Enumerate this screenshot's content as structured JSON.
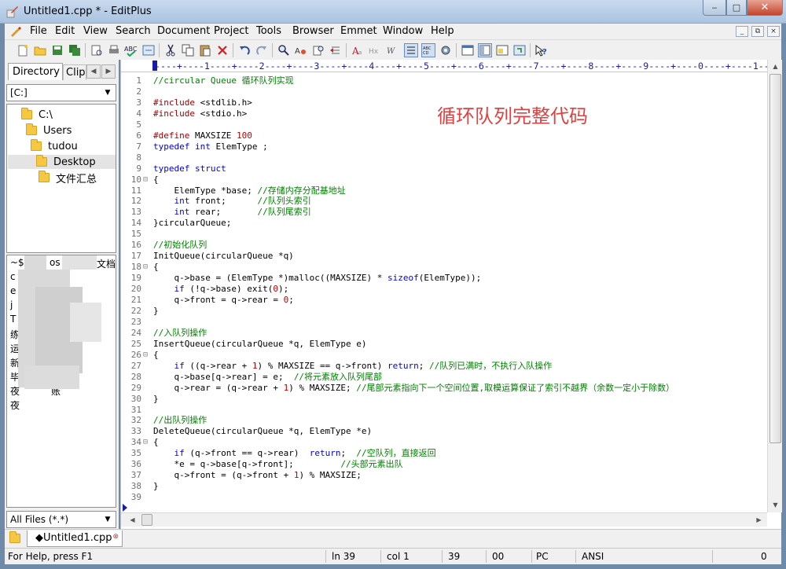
{
  "window": {
    "title": "Untitled1.cpp * - EditPlus",
    "min_glyph": "‒",
    "max_glyph": "□",
    "close_glyph": "✕"
  },
  "menu": [
    "File",
    "Edit",
    "View",
    "Search",
    "Document",
    "Project",
    "Tools",
    "Browser",
    "Emmet",
    "Window",
    "Help"
  ],
  "mdi_buttons": [
    "_",
    "⧉",
    "×"
  ],
  "left_panel": {
    "tabs": [
      "Directory",
      "Cliptext"
    ],
    "drive": "[C:]",
    "tree": [
      {
        "label": "C:\\",
        "selected": false
      },
      {
        "label": "Users",
        "selected": false
      },
      {
        "label": "tudou",
        "selected": false
      },
      {
        "label": "Desktop",
        "selected": true
      },
      {
        "label": "文件汇总",
        "selected": false
      }
    ],
    "file_list": [
      "~$",
      "os",
      "文档",
      "c",
      "e",
      "j",
      "T",
      "练",
      "运",
      "新",
      "毕",
      "夜",
      "夜",
      "账"
    ],
    "file_filter": "All Files (*.*)"
  },
  "editor": {
    "ruler": "----+----1----+----2----+----3----+----4----+----5----+----6----+----7----+----8----+----9----+----0----+----1---",
    "annotation": "循环队列完整代码",
    "lines": [
      {
        "n": "1",
        "fold": "",
        "segs": [
          [
            "c",
            "//circular Queue 循环队列实现"
          ]
        ]
      },
      {
        "n": "2",
        "fold": "",
        "segs": []
      },
      {
        "n": "3",
        "fold": "",
        "segs": [
          [
            "p",
            "#include"
          ],
          [
            "t",
            " <stdlib.h>"
          ]
        ]
      },
      {
        "n": "4",
        "fold": "",
        "segs": [
          [
            "p",
            "#include"
          ],
          [
            "t",
            " <stdio.h>"
          ]
        ]
      },
      {
        "n": "5",
        "fold": "",
        "segs": []
      },
      {
        "n": "6",
        "fold": "",
        "segs": [
          [
            "p",
            "#define"
          ],
          [
            "t",
            " MAXSIZE "
          ],
          [
            "n",
            "100"
          ]
        ]
      },
      {
        "n": "7",
        "fold": "",
        "segs": [
          [
            "k",
            "typedef"
          ],
          [
            "t",
            " "
          ],
          [
            "k",
            "int"
          ],
          [
            "t",
            " ElemType ;"
          ]
        ]
      },
      {
        "n": "8",
        "fold": "",
        "segs": []
      },
      {
        "n": "9",
        "fold": "",
        "segs": [
          [
            "k",
            "typedef"
          ],
          [
            "t",
            " "
          ],
          [
            "k",
            "struct"
          ]
        ]
      },
      {
        "n": "10",
        "fold": "⊟",
        "segs": [
          [
            "t",
            "{"
          ]
        ]
      },
      {
        "n": "11",
        "fold": "",
        "segs": [
          [
            "t",
            "    ElemType *base; "
          ],
          [
            "c",
            "//存储内存分配基地址"
          ]
        ]
      },
      {
        "n": "12",
        "fold": "",
        "segs": [
          [
            "t",
            "    "
          ],
          [
            "k",
            "int"
          ],
          [
            "t",
            " front;      "
          ],
          [
            "c",
            "//队列头索引"
          ]
        ]
      },
      {
        "n": "13",
        "fold": "",
        "segs": [
          [
            "t",
            "    "
          ],
          [
            "k",
            "int"
          ],
          [
            "t",
            " rear;       "
          ],
          [
            "c",
            "//队列尾索引"
          ]
        ]
      },
      {
        "n": "14",
        "fold": "",
        "segs": [
          [
            "t",
            "}circularQueue;"
          ]
        ]
      },
      {
        "n": "15",
        "fold": "",
        "segs": []
      },
      {
        "n": "16",
        "fold": "",
        "segs": [
          [
            "c",
            "//初始化队列"
          ]
        ]
      },
      {
        "n": "17",
        "fold": "",
        "segs": [
          [
            "t",
            "InitQueue(circularQueue *q)"
          ]
        ]
      },
      {
        "n": "18",
        "fold": "⊟",
        "segs": [
          [
            "t",
            "{"
          ]
        ]
      },
      {
        "n": "19",
        "fold": "",
        "segs": [
          [
            "t",
            "    q->base = (ElemType *)malloc((MAXSIZE) * "
          ],
          [
            "k",
            "sizeof"
          ],
          [
            "t",
            "(ElemType));"
          ]
        ]
      },
      {
        "n": "20",
        "fold": "",
        "segs": [
          [
            "t",
            "    "
          ],
          [
            "k",
            "if"
          ],
          [
            "t",
            " (!q->base) exit("
          ],
          [
            "n",
            "0"
          ],
          [
            "t",
            ");"
          ]
        ]
      },
      {
        "n": "21",
        "fold": "",
        "segs": [
          [
            "t",
            "    q->front = q->rear = "
          ],
          [
            "n",
            "0"
          ],
          [
            "t",
            ";"
          ]
        ]
      },
      {
        "n": "22",
        "fold": "",
        "segs": [
          [
            "t",
            "}"
          ]
        ]
      },
      {
        "n": "23",
        "fold": "",
        "segs": []
      },
      {
        "n": "24",
        "fold": "",
        "segs": [
          [
            "c",
            "//入队列操作"
          ]
        ]
      },
      {
        "n": "25",
        "fold": "",
        "segs": [
          [
            "t",
            "InsertQueue(circularQueue *q, ElemType e)"
          ]
        ]
      },
      {
        "n": "26",
        "fold": "⊟",
        "segs": [
          [
            "t",
            "{"
          ]
        ]
      },
      {
        "n": "27",
        "fold": "",
        "segs": [
          [
            "t",
            "    "
          ],
          [
            "k",
            "if"
          ],
          [
            "t",
            " ((q->rear + "
          ],
          [
            "n",
            "1"
          ],
          [
            "t",
            ") % MAXSIZE == q->front) "
          ],
          [
            "k",
            "return"
          ],
          [
            "t",
            "; "
          ],
          [
            "c",
            "//队列已满时，不执行入队操作"
          ]
        ]
      },
      {
        "n": "28",
        "fold": "",
        "segs": [
          [
            "t",
            "    q->base[q->rear] = e;  "
          ],
          [
            "c",
            "//将元素放入队列尾部"
          ]
        ]
      },
      {
        "n": "29",
        "fold": "",
        "segs": [
          [
            "t",
            "    q->rear = (q->rear + "
          ],
          [
            "n",
            "1"
          ],
          [
            "t",
            ") % MAXSIZE; "
          ],
          [
            "c",
            "//尾部元素指向下一个空间位置,取模运算保证了索引不越界（余数一定小于除数）"
          ]
        ]
      },
      {
        "n": "30",
        "fold": "",
        "segs": [
          [
            "t",
            "}"
          ]
        ]
      },
      {
        "n": "31",
        "fold": "",
        "segs": []
      },
      {
        "n": "32",
        "fold": "",
        "segs": [
          [
            "c",
            "//出队列操作"
          ]
        ]
      },
      {
        "n": "33",
        "fold": "",
        "segs": [
          [
            "t",
            "DeleteQueue(circularQueue *q, ElemType *e)"
          ]
        ]
      },
      {
        "n": "34",
        "fold": "⊟",
        "segs": [
          [
            "t",
            "{"
          ]
        ]
      },
      {
        "n": "35",
        "fold": "",
        "segs": [
          [
            "t",
            "    "
          ],
          [
            "k",
            "if"
          ],
          [
            "t",
            " (q->front == q->rear)  "
          ],
          [
            "k",
            "return"
          ],
          [
            "t",
            ";  "
          ],
          [
            "c",
            "//空队列，直接返回"
          ]
        ]
      },
      {
        "n": "36",
        "fold": "",
        "segs": [
          [
            "t",
            "    *e = q->base[q->front];         "
          ],
          [
            "c",
            "//头部元素出队"
          ]
        ]
      },
      {
        "n": "37",
        "fold": "",
        "segs": [
          [
            "t",
            "    q->front = (q->front + "
          ],
          [
            "n",
            "1"
          ],
          [
            "t",
            ") % MAXSIZE;"
          ]
        ]
      },
      {
        "n": "38",
        "fold": "",
        "segs": [
          [
            "t",
            "}"
          ]
        ]
      },
      {
        "n": "39",
        "fold": "",
        "segs": []
      }
    ]
  },
  "doc_tab": {
    "label": "◆Untitled1.cpp",
    "close": "⊗"
  },
  "status": {
    "help": "For Help, press F1",
    "ln": "ln 39",
    "col": "col 1",
    "chars": "39",
    "code": "00",
    "eol": "PC",
    "encoding": "ANSI",
    "extra": "0"
  }
}
